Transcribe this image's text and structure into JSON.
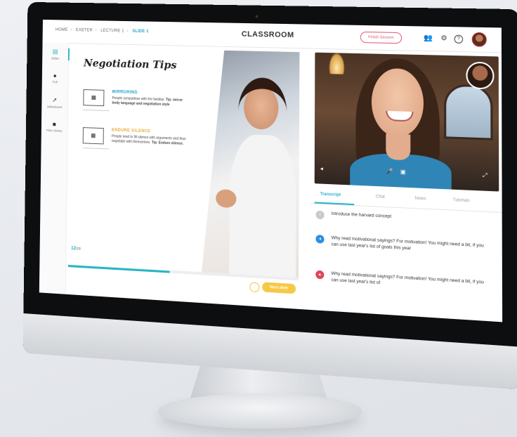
{
  "header": {
    "breadcrumb": [
      "HOME",
      "EXETER",
      "LECTURE 1",
      "SLIDE 1"
    ],
    "title": "CLASSROOM",
    "finish_label": "Finish Session"
  },
  "sidebar": {
    "items": [
      {
        "label": "Slides",
        "icon": "slides-icon"
      },
      {
        "label": "Poll",
        "icon": "poll-icon"
      },
      {
        "label": "Whiteboard",
        "icon": "pointer-icon"
      },
      {
        "label": "Files Library",
        "icon": "folder-icon"
      }
    ]
  },
  "slide": {
    "title": "Negotiation Tips",
    "tips": [
      {
        "name": "MIRRORING",
        "color": "#1aa3c9",
        "body": "People sympathise with the familiar.",
        "tip": "Tip: mirror body language and negotiation style"
      },
      {
        "name": "ENDURE SILENCE",
        "color": "#e9a93a",
        "body": "People tend to fill silence with arguments and thus negotiate with themselves.",
        "tip": "Tip: Endure silence."
      }
    ],
    "count": "12",
    "count_unit": "/28",
    "progress_fraction": 0.45,
    "next_label": "Next slide"
  },
  "tabs": [
    "Transcript",
    "Chat",
    "Notes",
    "Tutorials"
  ],
  "transcript": [
    {
      "icon": "info-icon",
      "color": "#c7c9cc",
      "text": "Introduce the harvard concept"
    },
    {
      "icon": "speaker-icon",
      "color": "#2f8fe0",
      "text": "Why read motivational sayings? For motivation! You might need a bit, if you can use last year's list of goals this year"
    },
    {
      "icon": "alert-icon",
      "color": "#e0455a",
      "text": "Why read motivational sayings? For motivation! You might need a bit, if you can use last year's list of"
    }
  ]
}
